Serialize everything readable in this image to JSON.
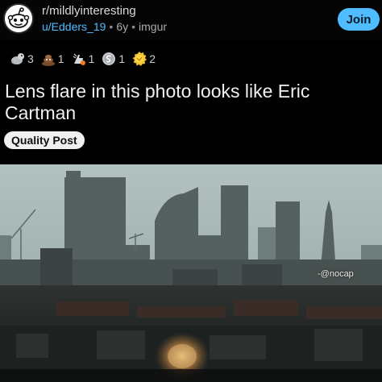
{
  "header": {
    "subreddit": "r/mildlyinteresting",
    "username": "u/Edders_19",
    "age": "6y",
    "source": "imgur",
    "join_label": "Join"
  },
  "awards": [
    {
      "icon": "wholesome-seal-icon",
      "count": "3"
    },
    {
      "icon": "poop-icon",
      "count": "1"
    },
    {
      "icon": "rocket-like-icon",
      "count": "1"
    },
    {
      "icon": "silver-coin-icon",
      "count": "1"
    },
    {
      "icon": "facepalm-icon",
      "count": "2"
    }
  ],
  "post": {
    "title": "Lens flare in this photo looks like Eric Cartman",
    "flair": "Quality Post"
  },
  "image": {
    "watermark": "-@nocap"
  },
  "colors": {
    "background": "#000000",
    "accent": "#4fbcff",
    "flair_bg": "#f0f0f0"
  }
}
